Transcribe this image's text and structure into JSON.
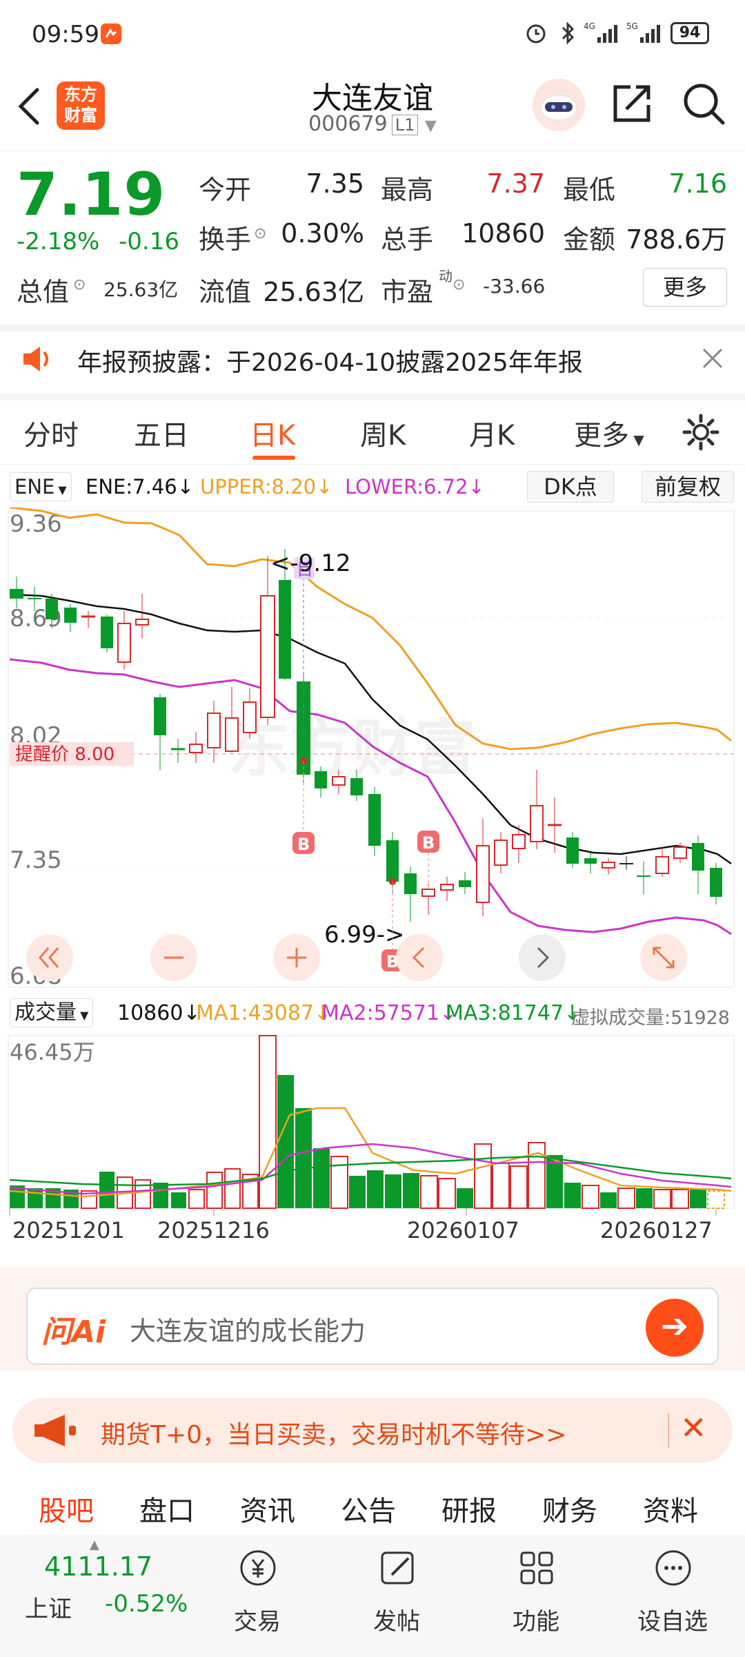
{
  "status_bar": {
    "time": "09:59",
    "battery": "94"
  },
  "header": {
    "logo_line1": "东方",
    "logo_line2": "财富",
    "stock_name": "大连友谊",
    "stock_code": "000679",
    "level": "L1"
  },
  "quote": {
    "price": "7.19",
    "change_pct": "-2.18%",
    "change": "-0.16",
    "fields": {
      "open_label": "今开",
      "open": "7.35",
      "high_label": "最高",
      "high": "7.37",
      "low_label": "最低",
      "low": "7.16",
      "turnover_label": "换手",
      "turnover": "0.30%",
      "volume_label": "总手",
      "volume": "10860",
      "amount_label": "金额",
      "amount": "788.6万",
      "mktcap_label": "总值",
      "mktcap": "25.63亿",
      "float_label": "流值",
      "float": "25.63亿",
      "pe_label": "市盈",
      "pe_sup": "动",
      "pe": "-33.66"
    },
    "more_label": "更多"
  },
  "notice": {
    "text": "年报预披露：于2026-04-10披露2025年年报"
  },
  "period_tabs": [
    "分时",
    "五日",
    "日K",
    "周K",
    "月K",
    "更多"
  ],
  "active_period": "日K",
  "indicator": {
    "name": "ENE",
    "ene": "ENE:7.46",
    "upper": "UPPER:8.20",
    "lower": "LOWER:6.72",
    "dk_label": "DK点",
    "adjust_label": "前复权"
  },
  "kline": {
    "y_labels": [
      "9.36",
      "8.69",
      "8.02",
      "7.35",
      "6.68"
    ],
    "alert_label": "提醒价 8.00",
    "max_label": "<-9.12",
    "min_label": "6.99->",
    "marker_buy": "B",
    "marker_target": "目",
    "watermark": "东方财富"
  },
  "volume": {
    "indicator_name": "成交量",
    "vol": "10860",
    "ma1": "MA1:43087",
    "ma2": "MA2:57571",
    "ma3": "MA3:81747",
    "virtual": "虚拟成交量:51928",
    "y_label": "46.45万",
    "dates": [
      "20251201",
      "20251216",
      "20260107",
      "20260127"
    ]
  },
  "ask_ai": {
    "logo": "问Ai",
    "placeholder": "大连友谊的成长能力"
  },
  "promo": {
    "text": "期货T+0，当日买卖，交易时机不等待>>"
  },
  "content_tabs": [
    "股吧",
    "盘口",
    "资讯",
    "公告",
    "研报",
    "财务",
    "资料"
  ],
  "active_content_tab": "股吧",
  "bottom_bar": {
    "index_value": "4111.17",
    "index_name": "上证",
    "index_change": "-0.52%",
    "items": [
      "交易",
      "发帖",
      "功能",
      "设自选"
    ]
  },
  "colors": {
    "accent": "#ff5a1f",
    "up": "#d8262c",
    "down": "#0a9a2a",
    "upper": "#f0a020",
    "lower": "#cc33cc",
    "ene": "#111111"
  }
}
